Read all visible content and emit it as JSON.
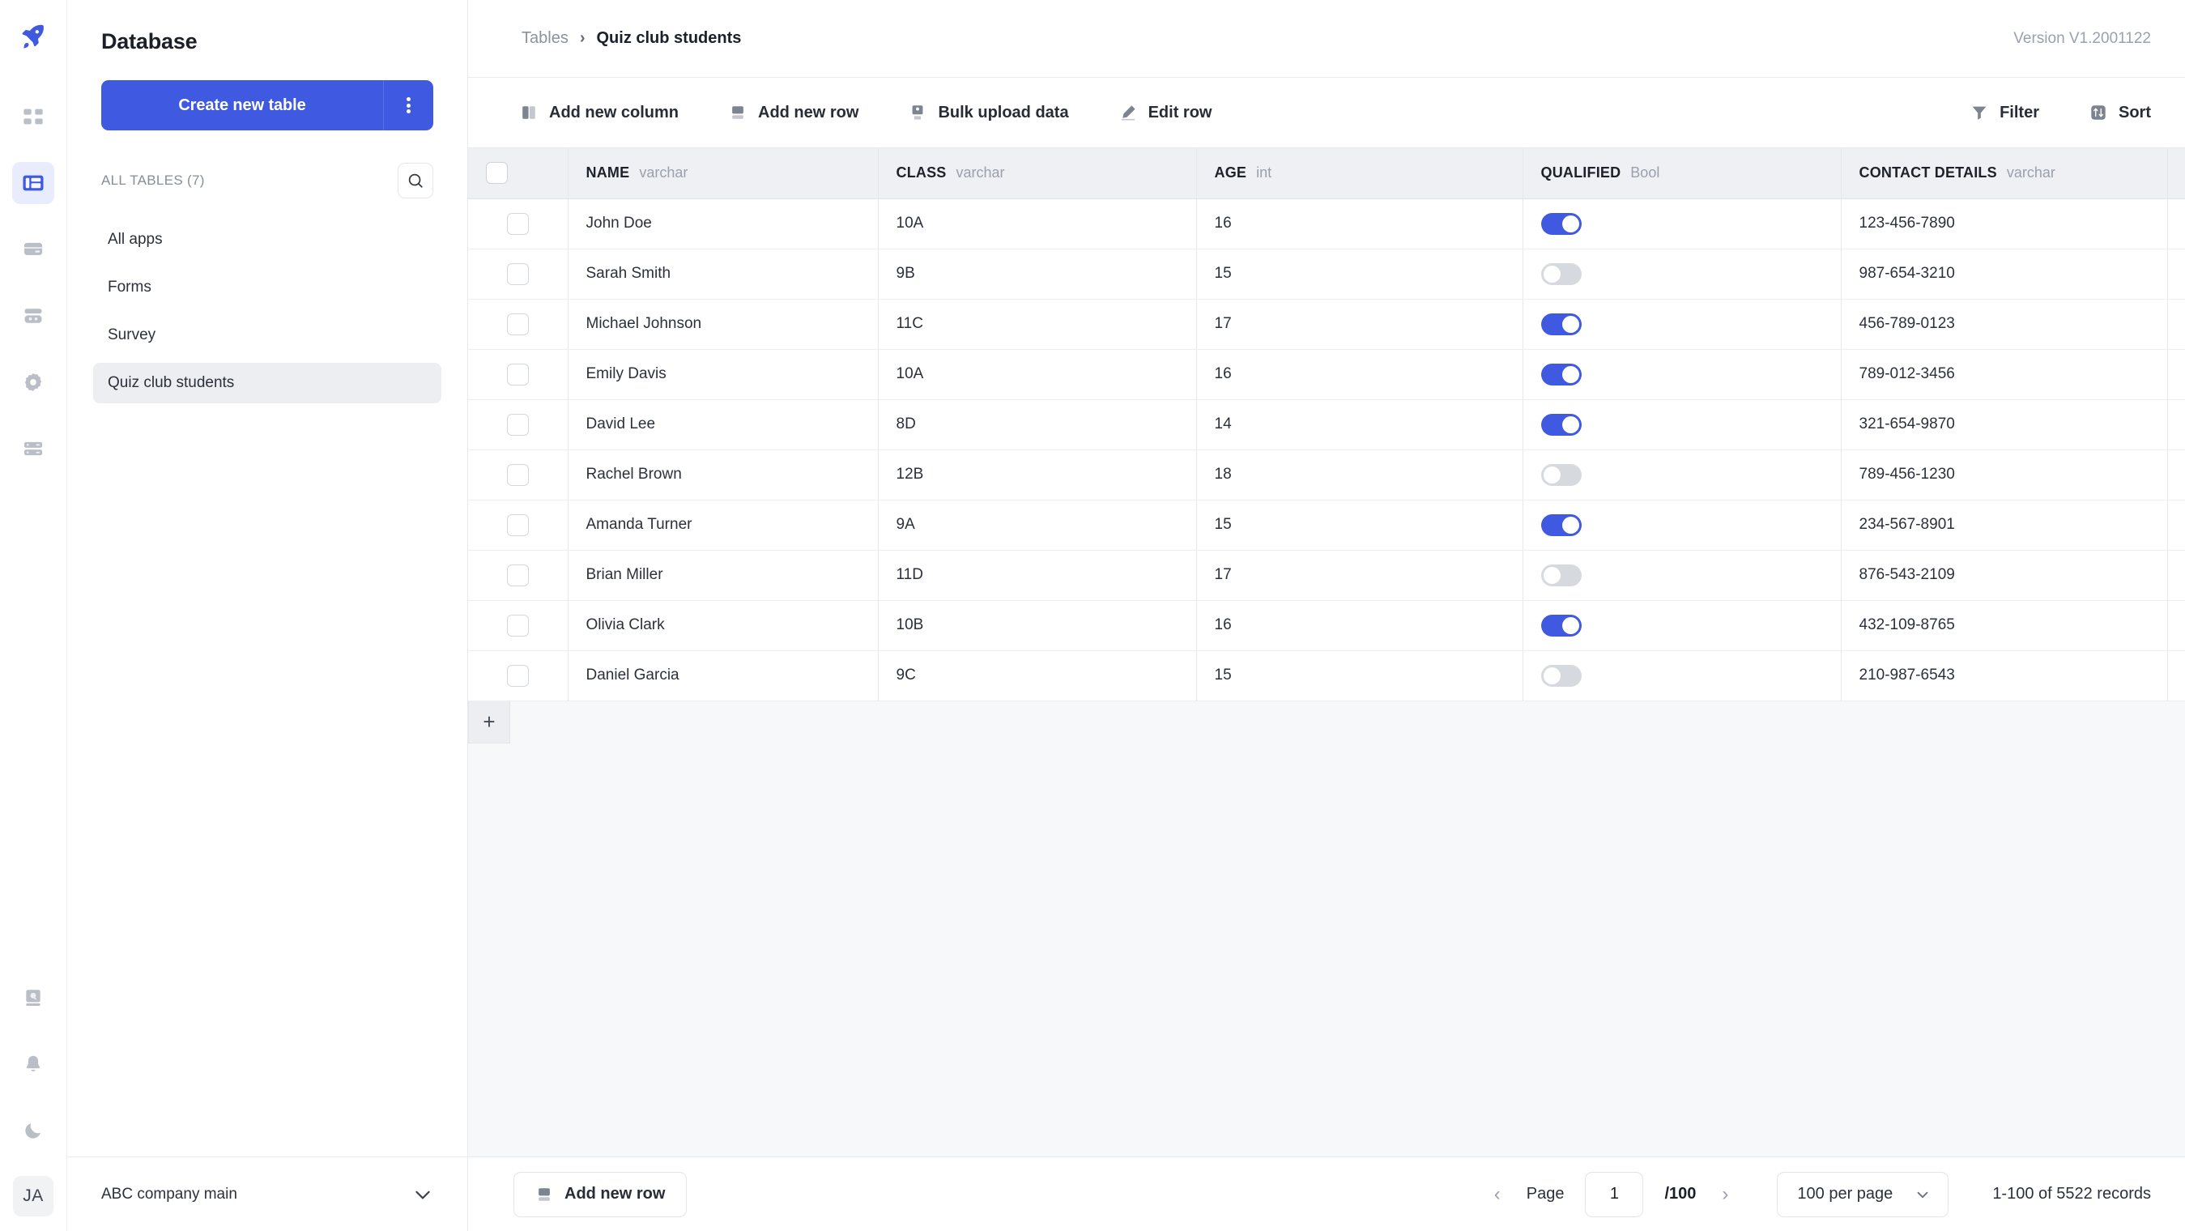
{
  "rail": {
    "items": [
      {
        "name": "rocket-logo-icon",
        "label": "Rocket"
      },
      {
        "name": "apps-grid-icon",
        "label": "Apps"
      },
      {
        "name": "database-table-icon",
        "label": "Database"
      },
      {
        "name": "storage-icon",
        "label": "Storage"
      },
      {
        "name": "workflow-icon",
        "label": "Workflow"
      },
      {
        "name": "settings-gear-icon",
        "label": "Settings"
      },
      {
        "name": "server-icon",
        "label": "Server"
      }
    ],
    "bottom": [
      {
        "name": "docs-search-icon",
        "label": "Docs"
      },
      {
        "name": "bell-icon",
        "label": "Notifications"
      },
      {
        "name": "moon-icon",
        "label": "Dark mode"
      }
    ],
    "avatar": "JA"
  },
  "sidebar": {
    "title": "Database",
    "create_button": "Create new table",
    "kebab_label": "More options",
    "all_tables_label": "ALL TABLES (7)",
    "search_label": "Search tables",
    "tables": [
      {
        "label": "All apps",
        "active": false
      },
      {
        "label": "Forms",
        "active": false
      },
      {
        "label": "Survey",
        "active": false
      },
      {
        "label": "Quiz club students",
        "active": true
      }
    ],
    "footer": {
      "company": "ABC company main",
      "chevron": "chevron-down"
    }
  },
  "header": {
    "breadcrumb_root": "Tables",
    "breadcrumb_sep": "›",
    "breadcrumb_current": "Quiz club students",
    "version": "Version V1.2001122"
  },
  "toolbar": {
    "left": [
      {
        "label": "Add new column",
        "icon": "column-icon"
      },
      {
        "label": "Add new row",
        "icon": "row-icon"
      },
      {
        "label": "Bulk upload data",
        "icon": "upload-icon"
      },
      {
        "label": "Edit row",
        "icon": "pencil-icon"
      }
    ],
    "right": [
      {
        "label": "Filter",
        "icon": "funnel-icon"
      },
      {
        "label": "Sort",
        "icon": "sort-icon"
      }
    ]
  },
  "table": {
    "add_column_plus": "+",
    "add_row_plus": "+",
    "columns": [
      {
        "name": "NAME",
        "type": "varchar"
      },
      {
        "name": "CLASS",
        "type": "varchar"
      },
      {
        "name": "AGE",
        "type": "int"
      },
      {
        "name": "QUALIFIED",
        "type": "Bool"
      },
      {
        "name": "CONTACT DETAILS",
        "type": "varchar"
      }
    ],
    "rows": [
      {
        "name": "John Doe",
        "class": "10A",
        "age": "16",
        "qualified": true,
        "contact": "123-456-7890"
      },
      {
        "name": "Sarah Smith",
        "class": "9B",
        "age": "15",
        "qualified": false,
        "contact": "987-654-3210"
      },
      {
        "name": "Michael Johnson",
        "class": "11C",
        "age": "17",
        "qualified": true,
        "contact": "456-789-0123"
      },
      {
        "name": "Emily Davis",
        "class": "10A",
        "age": "16",
        "qualified": true,
        "contact": "789-012-3456"
      },
      {
        "name": "David Lee",
        "class": "8D",
        "age": "14",
        "qualified": true,
        "contact": "321-654-9870"
      },
      {
        "name": "Rachel Brown",
        "class": "12B",
        "age": "18",
        "qualified": false,
        "contact": "789-456-1230"
      },
      {
        "name": "Amanda Turner",
        "class": "9A",
        "age": "15",
        "qualified": true,
        "contact": "234-567-8901"
      },
      {
        "name": "Brian Miller",
        "class": "11D",
        "age": "17",
        "qualified": false,
        "contact": "876-543-2109"
      },
      {
        "name": "Olivia Clark",
        "class": "10B",
        "age": "16",
        "qualified": true,
        "contact": "432-109-8765"
      },
      {
        "name": "Daniel Garcia",
        "class": "9C",
        "age": "15",
        "qualified": false,
        "contact": "210-987-6543"
      }
    ]
  },
  "footer": {
    "add_new_row": "Add new row",
    "page_label": "Page",
    "page_value": "1",
    "page_total": "/100",
    "prev_arrow": "‹",
    "next_arrow": "›",
    "per_page": "100 per page",
    "records": "1-100 of 5522 records"
  },
  "colors": {
    "accent": "#3f5ae0",
    "header_bg": "#eef0f3",
    "canvas": "#f7f8fa",
    "text": "#1b1f29",
    "muted": "#9aa0ac"
  }
}
